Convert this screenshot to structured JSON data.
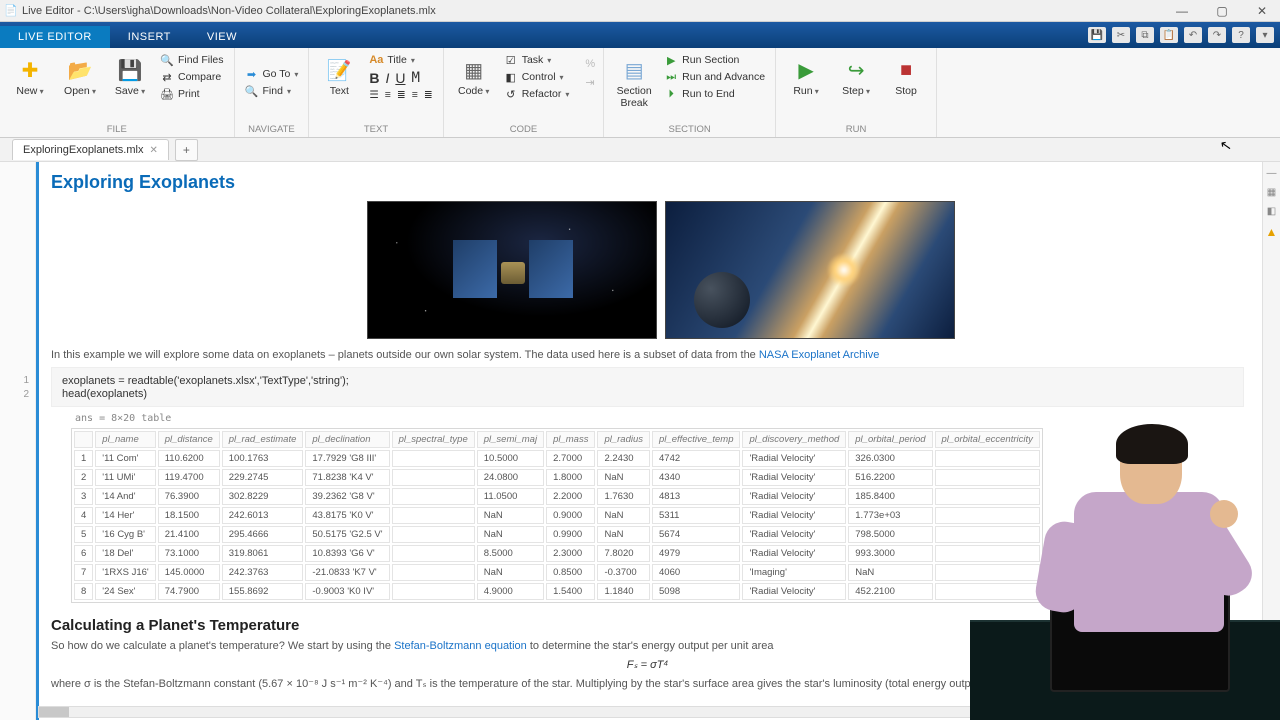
{
  "window": {
    "title": "Live Editor - C:\\Users\\igha\\Downloads\\Non-Video Collateral\\ExploringExoplanets.mlx"
  },
  "tabs": {
    "live_editor": "LIVE EDITOR",
    "insert": "INSERT",
    "view": "VIEW"
  },
  "ribbon": {
    "file": {
      "label": "FILE",
      "new": "New",
      "open": "Open",
      "save": "Save",
      "find_files": "Find Files",
      "compare": "Compare",
      "print": "Print"
    },
    "navigate": {
      "label": "NAVIGATE",
      "goto": "Go To",
      "find": "Find"
    },
    "text": {
      "label": "TEXT",
      "text": "Text",
      "title": "Title"
    },
    "code": {
      "label": "CODE",
      "code": "Code",
      "task": "Task",
      "control": "Control",
      "refactor": "Refactor"
    },
    "section": {
      "label": "SECTION",
      "break": "Section\nBreak",
      "run_section": "Run Section",
      "run_advance": "Run and Advance",
      "run_to_end": "Run to End"
    },
    "run": {
      "label": "RUN",
      "run": "Run",
      "step": "Step",
      "stop": "Stop"
    }
  },
  "filetab": {
    "name": "ExploringExoplanets.mlx"
  },
  "doc": {
    "title": "Exploring Exoplanets",
    "intro_pre": "In this example we will explore some data on exoplanets – planets outside our own solar system.  The data used here is a subset of data from the ",
    "intro_link": "NASA Exoplanet Archive",
    "code1": "exoplanets = readtable('exoplanets.xlsx','TextType','string');\nhead(exoplanets)",
    "ans": "ans = 8×20 table",
    "headers": [
      "pl_name",
      "pl_distance",
      "pl_rad_estimate",
      "pl_declination",
      "pl_spectral_type",
      "pl_semi_maj",
      "pl_mass",
      "pl_radius",
      "pl_effective_temp",
      "pl_discovery_method",
      "pl_orbital_period",
      "pl_orbital_eccentricity"
    ],
    "rows": [
      [
        "'11 Com'",
        "110.6200",
        "100.1763",
        "17.7929 'G8 III'",
        "",
        "10.5000",
        "2.7000",
        "2.2430",
        "4742",
        "'Radial Velocity'",
        "326.0300",
        ""
      ],
      [
        "'11 UMi'",
        "119.4700",
        "229.2745",
        "71.8238 'K4 V'",
        "",
        "24.0800",
        "1.8000",
        "NaN",
        "4340",
        "'Radial Velocity'",
        "516.2200",
        ""
      ],
      [
        "'14 And'",
        "76.3900",
        "302.8229",
        "39.2362 'G8 V'",
        "",
        "11.0500",
        "2.2000",
        "1.7630",
        "4813",
        "'Radial Velocity'",
        "185.8400",
        ""
      ],
      [
        "'14 Her'",
        "18.1500",
        "242.6013",
        "43.8175 'K0 V'",
        "",
        "NaN",
        "0.9000",
        "NaN",
        "5311",
        "'Radial Velocity'",
        "1.773e+03",
        ""
      ],
      [
        "'16 Cyg B'",
        "21.4100",
        "295.4666",
        "50.5175 'G2.5 V'",
        "",
        "NaN",
        "0.9900",
        "NaN",
        "5674",
        "'Radial Velocity'",
        "798.5000",
        ""
      ],
      [
        "'18 Del'",
        "73.1000",
        "319.8061",
        "10.8393 'G6 V'",
        "",
        "8.5000",
        "2.3000",
        "7.8020",
        "4979",
        "'Radial Velocity'",
        "993.3000",
        ""
      ],
      [
        "'1RXS J16'",
        "145.0000",
        "242.3763",
        "-21.0833 'K7 V'",
        "",
        "NaN",
        "0.8500",
        "-0.3700",
        "4060",
        "'Imaging'",
        "NaN",
        ""
      ],
      [
        "'24 Sex'",
        "74.7900",
        "155.8692",
        "-0.9003 'K0 IV'",
        "",
        "4.9000",
        "1.5400",
        "1.1840",
        "5098",
        "'Radial Velocity'",
        "452.2100",
        ""
      ]
    ],
    "sect2_title": "Calculating a Planet's Temperature",
    "sect2_p1a": "So how do we calculate a planet's temperature?  We start by using the ",
    "sect2_link": "Stefan-Boltzmann equation",
    "sect2_p1b": " to determine the star's energy output per unit area",
    "eqn1": "Fₛ = σT⁴",
    "sect2_p2": "where σ is the Stefan-Boltzmann constant (5.67 × 10⁻⁸ J s⁻¹ m⁻² K⁻⁴) and Tₛ is the temperature of the star.  Multiplying by the star's surface area gives the star's luminosity (total energy output) in watts."
  },
  "gutter": [
    "1",
    "2"
  ]
}
